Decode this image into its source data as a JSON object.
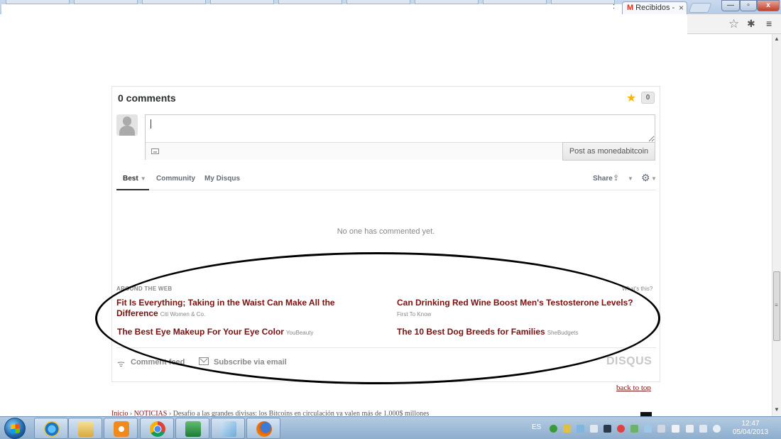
{
  "browser": {
    "active_tab": {
      "title": "Recibidos - ",
      "icon": "gmail-icon"
    },
    "tab_separator": ":",
    "window_controls": {
      "minimize": "—",
      "maximize": "▫",
      "close": "x"
    },
    "toolbar_icons": [
      "star-icon",
      "extension-icon",
      "menu-icon"
    ]
  },
  "disqus": {
    "comment_count_label": "0 comments",
    "favorite_count": "0",
    "reply_placeholder": "",
    "post_button": "Post as monedabitcoin",
    "tabs": [
      {
        "label": "Best",
        "active": true
      },
      {
        "label": "Community",
        "active": false
      },
      {
        "label": "My Disqus",
        "active": false
      }
    ],
    "share_label": "Share",
    "empty_message": "No one has commented yet.",
    "around_web": {
      "heading": "AROUND THE WEB",
      "whats_this": "What's this?",
      "items": [
        {
          "title": "Fit Is Everything; Taking in the Waist Can Make All the Difference",
          "source": "Citi Women & Co."
        },
        {
          "title": "Can Drinking Red Wine Boost Men's Testosterone Levels?",
          "source": "First To Know"
        },
        {
          "title": "The Best Eye Makeup For Your Eye Color",
          "source": "YouBeauty"
        },
        {
          "title": "The 10 Best Dog Breeds for Families",
          "source": "SheBudgets"
        }
      ]
    },
    "footer": {
      "comment_feed": "Comment feed",
      "subscribe": "Subscribe via email",
      "logo": "DISQUS"
    }
  },
  "page": {
    "back_to_top": "back to top",
    "breadcrumb": {
      "home": "Inicio",
      "sep": "›",
      "section": "NOTICIAS",
      "current": "Desafío a las grandes divisas: los Bitcoins en circulación ya valen más de 1.000$ millones"
    }
  },
  "taskbar": {
    "apps": [
      "internet-explorer-icon",
      "file-explorer-icon",
      "media-player-icon",
      "chrome-icon",
      "excel-icon",
      "notepad-icon",
      "firefox-icon"
    ],
    "language": "ES",
    "time": "12:47",
    "date": "05/04/2013"
  },
  "colors": {
    "accent_link": "#7a1010",
    "disqus_text": "#2a2e2e",
    "star": "#f5b800",
    "taskbar": "#9ab8d6"
  }
}
